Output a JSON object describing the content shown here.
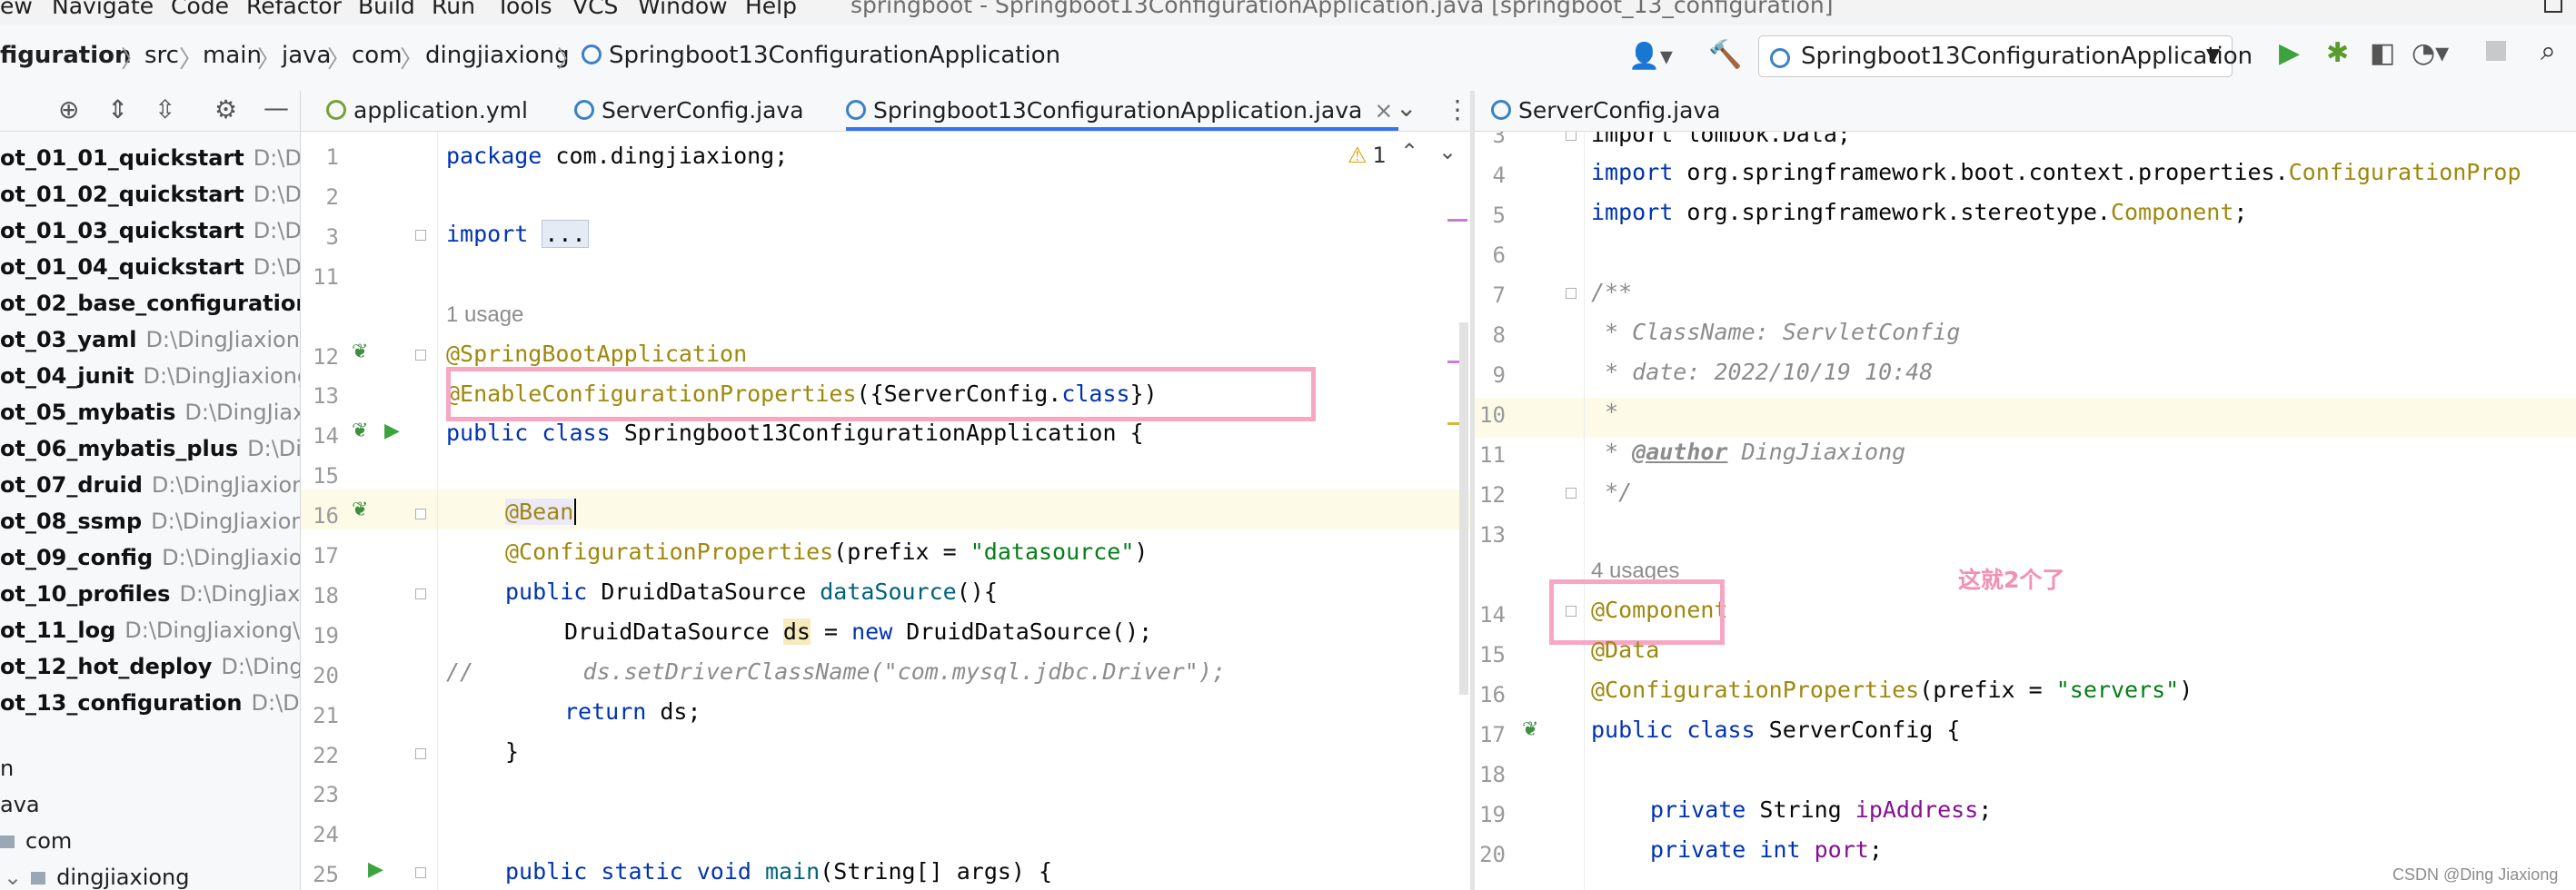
{
  "window": {
    "title": "springboot - Springboot13ConfigurationApplication.java [springboot_13_configuration]"
  },
  "menu": [
    "ew",
    "Navigate",
    "Code",
    "Refactor",
    "Build",
    "Run",
    "Tools",
    "VCS",
    "Window",
    "Help"
  ],
  "breadcrumb": [
    "figuration",
    "src",
    "main",
    "java",
    "com",
    "dingjiaxiong",
    "Springboot13ConfigurationApplication"
  ],
  "run_config": "Springboot13ConfigurationApplication",
  "project_tree": [
    {
      "name": "ot_01_01_quickstart",
      "path": "D:\\Ding..."
    },
    {
      "name": "ot_01_02_quickstart",
      "path": "D:\\Ding..."
    },
    {
      "name": "ot_01_03_quickstart",
      "path": "D:\\Ding..."
    },
    {
      "name": "ot_01_04_quickstart",
      "path": "D:\\Ding..."
    },
    {
      "name": "ot_02_base_configuration",
      "path": "D"
    },
    {
      "name": "ot_03_yaml",
      "path": "D:\\DingJiaxiong\\"
    },
    {
      "name": "ot_04_junit",
      "path": "D:\\DingJiaxiong\\"
    },
    {
      "name": "ot_05_mybatis",
      "path": "D:\\DingJiaxion"
    },
    {
      "name": "ot_06_mybatis_plus",
      "path": "D:\\Ding..."
    },
    {
      "name": "ot_07_druid",
      "path": "D:\\DingJiaxiong\\"
    },
    {
      "name": "ot_08_ssmp",
      "path": "D:\\DingJiaxiong\\"
    },
    {
      "name": "ot_09_config",
      "path": "D:\\DingJiaxiong"
    },
    {
      "name": "ot_10_profiles",
      "path": "D:\\DingJiaxion"
    },
    {
      "name": "ot_11_log",
      "path": "D:\\DingJiaxiong\\Id"
    },
    {
      "name": "ot_12_hot_deploy",
      "path": "D:\\DingJia"
    },
    {
      "name": "ot_13_configuration",
      "path": "D:\\Ding"
    }
  ],
  "project_tree_lower": [
    "n",
    "ava",
    "com",
    "dingjiaxiong"
  ],
  "left_tabs": [
    "application.yml",
    "ServerConfig.java",
    "Springboot13ConfigurationApplication.java"
  ],
  "right_tabs": [
    "ServerConfig.java"
  ],
  "left_editor": {
    "line_numbers": [
      "1",
      "2",
      "3",
      "11",
      "",
      "12",
      "13",
      "14",
      "15",
      "16",
      "17",
      "18",
      "19",
      "20",
      "21",
      "22",
      "23",
      "24",
      "25"
    ],
    "usage_hint": "1 usage",
    "warning_count": "1",
    "package_line": "package com.dingjiaxiong;",
    "import_kw": "import",
    "import_fold": "...",
    "line12": "@SpringBootApplication",
    "line13_ann": "@EnableConfigurationProperties",
    "line13_rest": "({ServerConfig.",
    "line13_class": "class",
    "line13_end": "})",
    "line14_kw": "public class",
    "line14_name": "Springboot13ConfigurationApplication {",
    "line16": "@Bean",
    "line17_ann": "@ConfigurationProperties",
    "line17_mid": "(prefix = ",
    "line17_str": "\"datasource\"",
    "line17_end": ")",
    "line18_kw": "public",
    "line18_type": "DruidDataSource ",
    "line18_fn": "dataSource",
    "line18_end": "(){",
    "line19_a": "DruidDataSource ",
    "line19_var": "ds",
    "line19_b": " = ",
    "line19_kw": "new",
    "line19_c": " DruidDataSource();",
    "line20": "//        ds.setDriverClassName(\"com.mysql.jdbc.Driver\");",
    "line21_kw": "return",
    "line21_rest": " ds;",
    "line22": "}",
    "line25_kw": "public static void",
    "line25_fn": "main",
    "line25_rest": "(String[] args) {"
  },
  "right_editor": {
    "line_numbers": [
      "3",
      "4",
      "5",
      "6",
      "7",
      "8",
      "9",
      "10",
      "11",
      "12",
      "13",
      "",
      "14",
      "15",
      "16",
      "17",
      "18",
      "19",
      "20"
    ],
    "line3": "import lombok.Data;",
    "line4_kw": "import",
    "line4_pkg": " org.springframework.boot.context.properties.",
    "line4_cls": "ConfigurationProp",
    "line5_kw": "import",
    "line5_pkg": " org.springframework.stereotype.",
    "line5_cls": "Component",
    "line5_end": ";",
    "line7": "/**",
    "line8": " * ClassName: ServletConfig",
    "line9": " * date: 2022/10/19 10:48",
    "line10": " *",
    "line11_a": " * ",
    "line11_tag": "@author",
    "line11_b": " DingJiaxiong",
    "line12": " */",
    "usage_hint": "4 usages",
    "line14": "@Component",
    "line15": "@Data",
    "line16_ann": "@ConfigurationProperties",
    "line16_mid": "(prefix = ",
    "line16_str": "\"servers\"",
    "line16_end": ")",
    "line17_kw": "public class",
    "line17_name": " ServerConfig {",
    "line19_kw": "private",
    "line19_type": " String ",
    "line19_fld": "ipAddress",
    "line19_end": ";",
    "line20_kw": "private int",
    "line20_fld": " port",
    "line20_end": ";"
  },
  "annotation_note": "这就2个了",
  "watermark": "CSDN @Ding Jiaxiong",
  "colors": {
    "accent": "#3574f0",
    "highlight_box": "#f7a6c4",
    "annotation": "#9e880d",
    "keyword": "#0033b3",
    "string": "#067d17",
    "note": "#f48fb1"
  }
}
